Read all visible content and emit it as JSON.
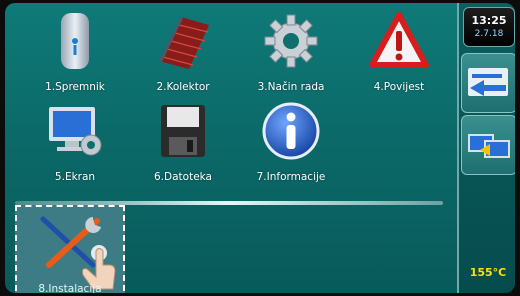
{
  "tiles": [
    {
      "label": "1.Spremnik",
      "icon": "storage-tank-icon"
    },
    {
      "label": "2.Kolektor",
      "icon": "solar-collector-icon"
    },
    {
      "label": "3.Način rada",
      "icon": "gear-icon"
    },
    {
      "label": "4.Povijest",
      "icon": "warning-triangle-icon"
    },
    {
      "label": "5.Ekran",
      "icon": "monitor-settings-icon"
    },
    {
      "label": "6.Datoteka",
      "icon": "floppy-disk-icon"
    },
    {
      "label": "7.Informacije",
      "icon": "info-icon"
    },
    {
      "label": "8.Instalacija",
      "icon": "tools-icon"
    }
  ],
  "sidebar": {
    "time": "13:25",
    "date": "2.7.18",
    "buttons": [
      {
        "icon": "arrow-left-icon"
      },
      {
        "icon": "screen-switch-icon"
      }
    ],
    "temperature": "155°C"
  },
  "colors": {
    "accent": "#0f7a78",
    "temperature": "#ffe000",
    "warning_red": "#d71d1d"
  }
}
